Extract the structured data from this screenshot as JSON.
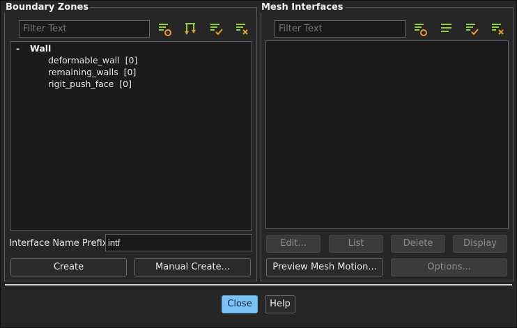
{
  "boundary_zones": {
    "title": "Boundary Zones",
    "filter_placeholder": "Filter Text",
    "tree": {
      "group_toggle": "-",
      "group_label": "Wall",
      "items": [
        {
          "label": "deformable_wall",
          "count": "[0]"
        },
        {
          "label": "remaining_walls",
          "count": "[0]"
        },
        {
          "label": "rigit_push_face",
          "count": "[0]"
        }
      ]
    },
    "prefix_label": "Interface Name Prefix",
    "prefix_value": "intf",
    "create_label": "Create",
    "manual_create_label": "Manual Create..."
  },
  "mesh_interfaces": {
    "title": "Mesh Interfaces",
    "filter_placeholder": "Filter Text",
    "edit_label": "Edit...",
    "list_label": "List",
    "delete_label": "Delete",
    "display_label": "Display",
    "preview_label": "Preview Mesh Motion...",
    "options_label": "Options..."
  },
  "footer": {
    "close_label": "Close",
    "help_label": "Help"
  },
  "colors": {
    "icon_green": "#8fcf3a",
    "icon_orange": "#f0a020",
    "accent_blue": "#7cc3f5"
  }
}
